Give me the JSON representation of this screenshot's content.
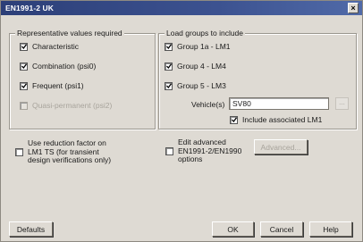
{
  "window": {
    "title": "EN1991-2 UK",
    "close_glyph": "×"
  },
  "representative": {
    "legend": "Representative values required",
    "items": [
      {
        "label": "Characteristic",
        "checked": true,
        "enabled": true
      },
      {
        "label": "Combination (psi0)",
        "checked": true,
        "enabled": true
      },
      {
        "label": "Frequent (psi1)",
        "checked": true,
        "enabled": true
      },
      {
        "label": "Quasi-permanent (psi2)",
        "checked": false,
        "enabled": false
      }
    ]
  },
  "load_groups": {
    "legend": "Load groups to include",
    "items": [
      {
        "label": "Group 1a - LM1",
        "checked": true
      },
      {
        "label": "Group 4 - LM4",
        "checked": true
      },
      {
        "label": "Group 5 - LM3",
        "checked": true
      }
    ],
    "vehicles_label": "Vehicle(s)",
    "vehicles_value": "SV80",
    "browse_label": "...",
    "include_lm1_label": "Include associated LM1",
    "include_lm1_checked": true
  },
  "reduction": {
    "label": "Use reduction factor on LM1 TS (for transient design verifications only)",
    "checked": false
  },
  "advanced": {
    "label": "Edit advanced EN1991-2/EN1990 options",
    "checked": false,
    "button_label": "Advanced..."
  },
  "footer": {
    "defaults_label": "Defaults",
    "ok_label": "OK",
    "cancel_label": "Cancel",
    "help_label": "Help"
  }
}
